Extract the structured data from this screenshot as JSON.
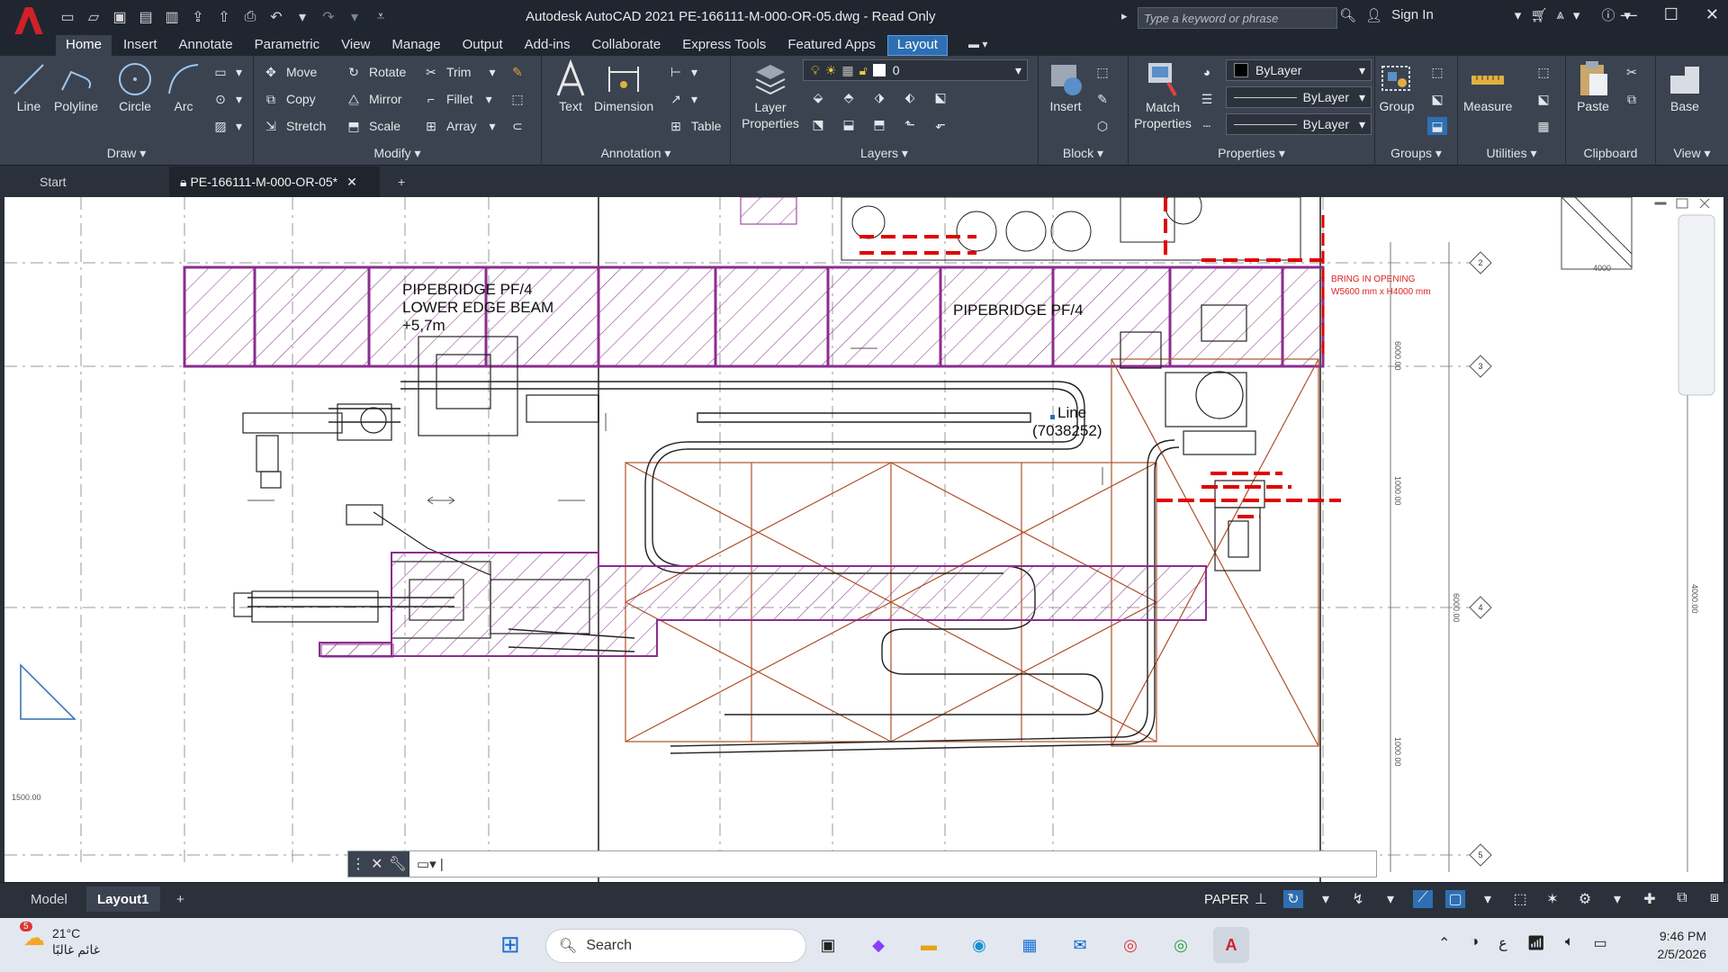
{
  "titlebar": {
    "title": "Autodesk AutoCAD 2021    PE-166111-M-000-OR-05.dwg - Read Only",
    "search_placeholder": "Type a keyword or phrase",
    "sign_in": "Sign In"
  },
  "ribbon_tabs": [
    "Home",
    "Insert",
    "Annotate",
    "Parametric",
    "View",
    "Manage",
    "Output",
    "Add-ins",
    "Collaborate",
    "Express Tools",
    "Featured Apps",
    "Layout"
  ],
  "ribbon": {
    "draw": {
      "title": "Draw",
      "line": "Line",
      "polyline": "Polyline",
      "circle": "Circle",
      "arc": "Arc"
    },
    "modify": {
      "title": "Modify",
      "move": "Move",
      "rotate": "Rotate",
      "trim": "Trim",
      "copy": "Copy",
      "mirror": "Mirror",
      "fillet": "Fillet",
      "stretch": "Stretch",
      "scale": "Scale",
      "array": "Array"
    },
    "annotation": {
      "title": "Annotation",
      "text": "Text",
      "dimension": "Dimension",
      "table": "Table"
    },
    "layers": {
      "title": "Layers",
      "layer_properties": "Layer Properties",
      "current_layer": "0"
    },
    "block": {
      "title": "Block",
      "insert": "Insert"
    },
    "properties": {
      "title": "Properties",
      "match": "Match Properties",
      "color": "ByLayer",
      "linetype": "ByLayer",
      "lineweight": "ByLayer"
    },
    "groups": {
      "title": "Groups",
      "group": "Group"
    },
    "utilities": {
      "title": "Utilities",
      "measure": "Measure"
    },
    "clipboard": {
      "title": "Clipboard",
      "paste": "Paste"
    },
    "view": {
      "title": "View",
      "base": "Base"
    }
  },
  "file_tabs": {
    "start": "Start",
    "document": "PE-166111-M-000-OR-05*"
  },
  "drawing": {
    "label_pipebridge_lower": [
      "PIPEBRIDGE PF/4",
      "LOWER EDGE BEAM",
      "+5,7m"
    ],
    "label_pipebridge": "PIPEBRIDGE PF/4",
    "label_line": [
      "Line",
      "(7038252)"
    ],
    "label_opening": [
      "BRING IN OPENING",
      "W5600 mm x H4000 mm"
    ],
    "dim_labels": [
      "6000.00",
      "1000.00",
      "6000.00",
      "4000.00",
      "1000.00",
      "4000",
      "1500.00"
    ],
    "grid_bubbles": [
      "2",
      "3",
      "4",
      "5"
    ]
  },
  "layout_tabs": {
    "model": "Model",
    "layout1": "Layout1"
  },
  "status": {
    "paper": "PAPER"
  },
  "taskbar": {
    "weather_temp": "21°C",
    "weather_desc": "غائم غالبًا",
    "weather_badge": "5",
    "search": "Search",
    "lang": "ع",
    "time": "9:46 PM",
    "date": "2/5/2026"
  },
  "colors": {
    "accent": "#2e6fb3",
    "hatch": "#8b2d8f",
    "red_markup": "#e00000",
    "brown": "#b0502a"
  }
}
